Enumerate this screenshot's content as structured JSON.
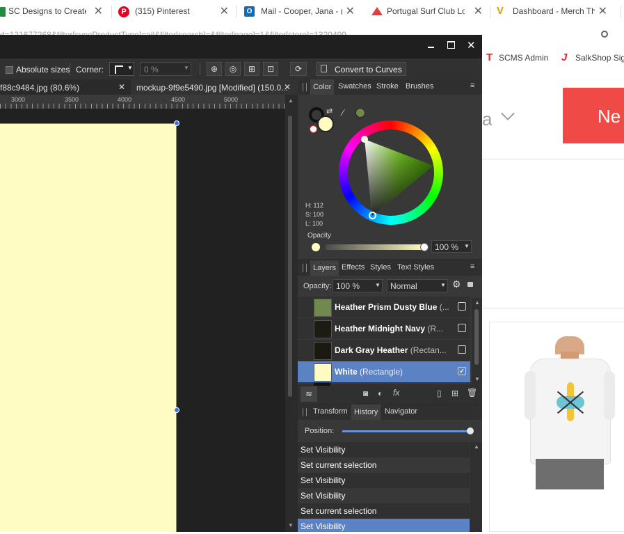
{
  "browser": {
    "tabs": [
      {
        "title": "SC Designs to Create",
        "icon": "google-sheets-icon",
        "color": "#1e8e3e"
      },
      {
        "title": "(315) Pinterest",
        "icon": "pinterest-icon",
        "color": "#e60023"
      },
      {
        "title": "Mail - Cooper, Jana - (",
        "icon": "outlook-icon",
        "color": "#0f6cbd"
      },
      {
        "title": "Portugal Surf Club Lo",
        "icon": "site-logo-icon",
        "color": "#e2403a"
      },
      {
        "title": "Dashboard - Merch Th",
        "icon": "merch-icon",
        "color": "#f3b200"
      }
    ],
    "url_fragment": "d=121677268&filter[syncProductType]=all&filter[search]=&filter[page]=1&filter[store]=1320499",
    "bookmarks": [
      {
        "label": "SCMS Admin",
        "icon": "t-logo-icon"
      },
      {
        "label": "SalkShop Sign",
        "icon": "j-logo-icon"
      }
    ]
  },
  "affinity": {
    "context": {
      "absolute_sizes_label": "Absolute sizes",
      "corner_label": "Corner:",
      "corner_value": "0 %",
      "convert_label": "Convert to Curves"
    },
    "doc_tabs": [
      {
        "title": "f88c9484.jpg (80.6%)"
      },
      {
        "title": "mockup-9f9e5490.jpg [Modified] (150.0..."
      }
    ],
    "ruler_ticks": [
      "3000",
      "3500",
      "4000",
      "4500",
      "5000"
    ],
    "color_panel": {
      "tabs": [
        "Color",
        "Swatches",
        "Stroke",
        "Brushes"
      ],
      "h": "H: 112",
      "s": "S: 100",
      "l": "L: 100",
      "opacity_label": "Opacity",
      "opacity_value": "100 %",
      "fill_color": "#fffcc3"
    },
    "layers_panel": {
      "tabs": [
        "Layers",
        "Effects",
        "Styles",
        "Text Styles"
      ],
      "opacity_label": "Opacity:",
      "opacity_value": "100 %",
      "blend_mode": "Normal",
      "layers": [
        {
          "name": "Heather  Prism Dusty Blue",
          "kind": "(...",
          "color": "#6f8a4c",
          "checked": false,
          "selected": false
        },
        {
          "name": "Heather  Midnight Navy",
          "kind": "(R...",
          "color": "#1d1c14",
          "checked": false,
          "selected": false
        },
        {
          "name": "Dark Gray Heather",
          "kind": "(Rectan...",
          "color": "#1c1a10",
          "checked": false,
          "selected": false
        },
        {
          "name": "White",
          "kind": "(Rectangle)",
          "color": "#fffcc3",
          "checked": true,
          "selected": true
        }
      ]
    },
    "history_panel": {
      "tabs": [
        "Transform",
        "History",
        "Navigator"
      ],
      "position_label": "Position:",
      "items": [
        {
          "label": "Set Visibility",
          "selected": false
        },
        {
          "label": "Set current selection",
          "selected": false
        },
        {
          "label": "Set Visibility",
          "selected": false
        },
        {
          "label": "Set Visibility",
          "selected": false
        },
        {
          "label": "Set current selection",
          "selected": false
        },
        {
          "label": "Set Visibility",
          "selected": true
        }
      ]
    }
  },
  "web": {
    "partial_text": "a",
    "button_label": "Ne"
  }
}
